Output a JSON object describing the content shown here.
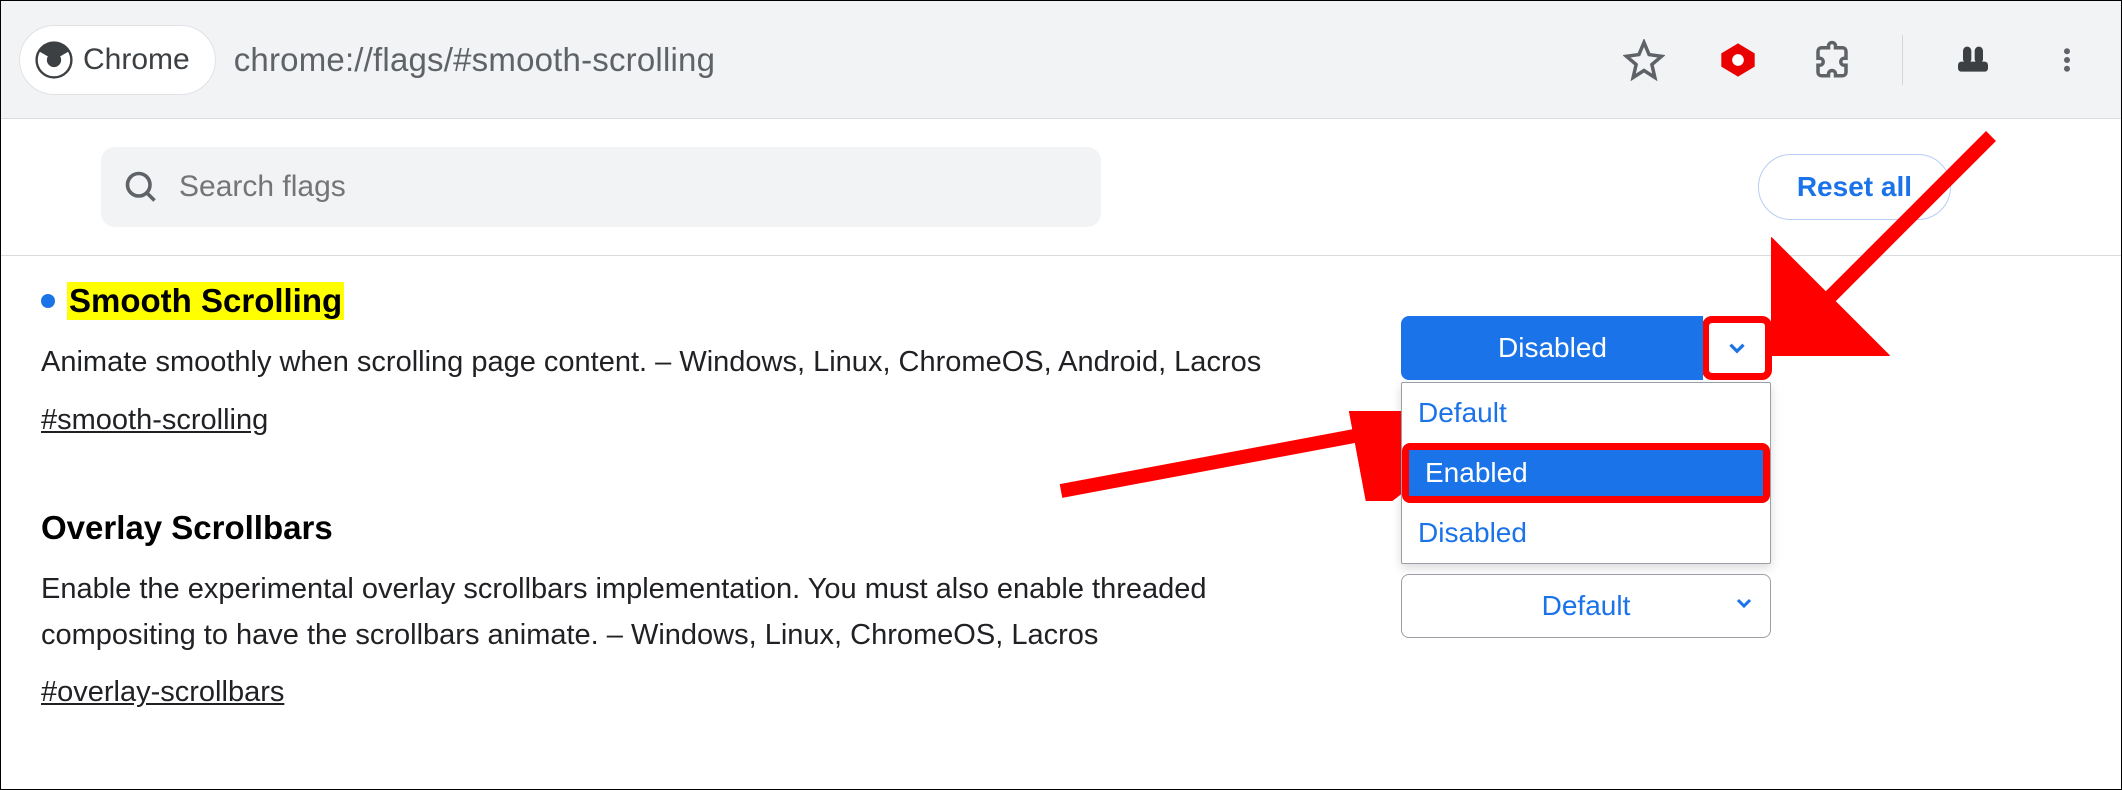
{
  "addressbar": {
    "app_label": "Chrome",
    "url": "chrome://flags/#smooth-scrolling"
  },
  "toolbar": {
    "search_placeholder": "Search flags",
    "reset_all_label": "Reset all"
  },
  "flags": {
    "smooth": {
      "title": "Smooth Scrolling",
      "desc": "Animate smoothly when scrolling page content. – Windows, Linux, ChromeOS, Android, Lacros",
      "tag": "#smooth-scrolling",
      "select": {
        "current": "Disabled",
        "options": {
          "0": "Default",
          "1": "Enabled",
          "2": "Disabled"
        },
        "highlighted": "Enabled"
      }
    },
    "overlay": {
      "title": "Overlay Scrollbars",
      "desc": "Enable the experimental overlay scrollbars implementation. You must also enable threaded compositing to have the scrollbars animate. – Windows, Linux, ChromeOS, Lacros",
      "tag": "#overlay-scrollbars",
      "select": {
        "current": "Default"
      }
    }
  }
}
